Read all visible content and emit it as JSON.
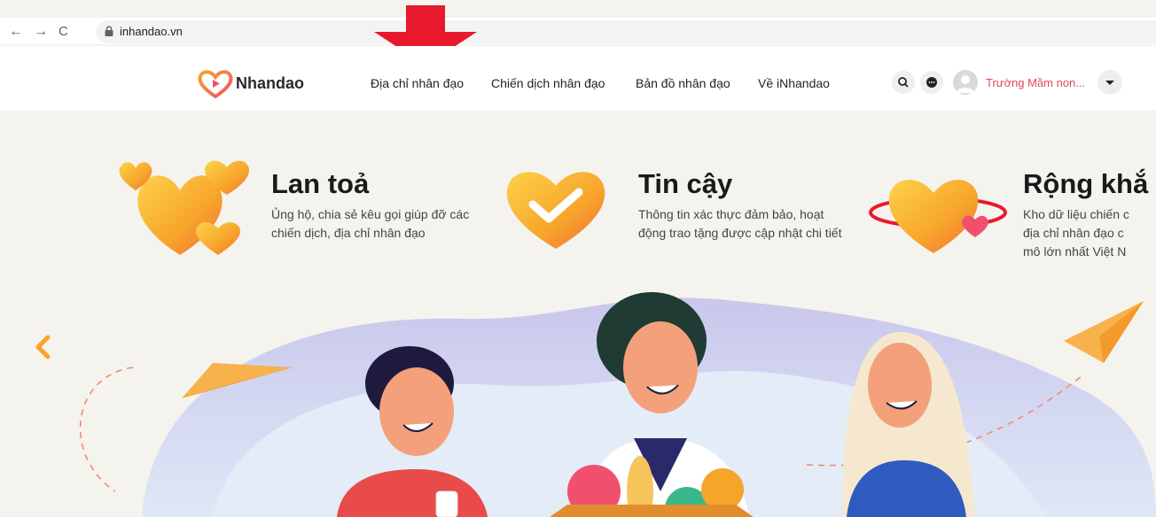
{
  "browser": {
    "url": "inhandao.vn",
    "back_icon": "←",
    "forward_icon": "→",
    "reload_icon": "C"
  },
  "header": {
    "logo_text": "Nhandao",
    "menu": [
      {
        "label": "Địa chỉ nhân đạo"
      },
      {
        "label": "Chiến dịch nhân đạo"
      },
      {
        "label": "Bản đồ nhân đạo"
      },
      {
        "label": "Về iNhandao"
      }
    ],
    "user_name": "Trường Mầm non..."
  },
  "features": [
    {
      "title": "Lan toả",
      "desc": "Ủng hộ, chia sẻ kêu gọi giúp đỡ các chiến dịch, địa chỉ nhân đạo"
    },
    {
      "title": "Tin cậy",
      "desc": "Thông tin xác thực đảm bảo, hoạt động trao tặng được cập nhật chi tiết"
    },
    {
      "title": "Rộng khắ",
      "desc": "Kho dữ liệu chiến c\nđịa chỉ nhân đạo c\nmô lớn nhất Việt N"
    }
  ],
  "colors": {
    "accent_red": "#e8192c",
    "brand_orange": "#f7a42b",
    "brand_pink": "#f0506e",
    "user_name_color": "#e0475d"
  }
}
